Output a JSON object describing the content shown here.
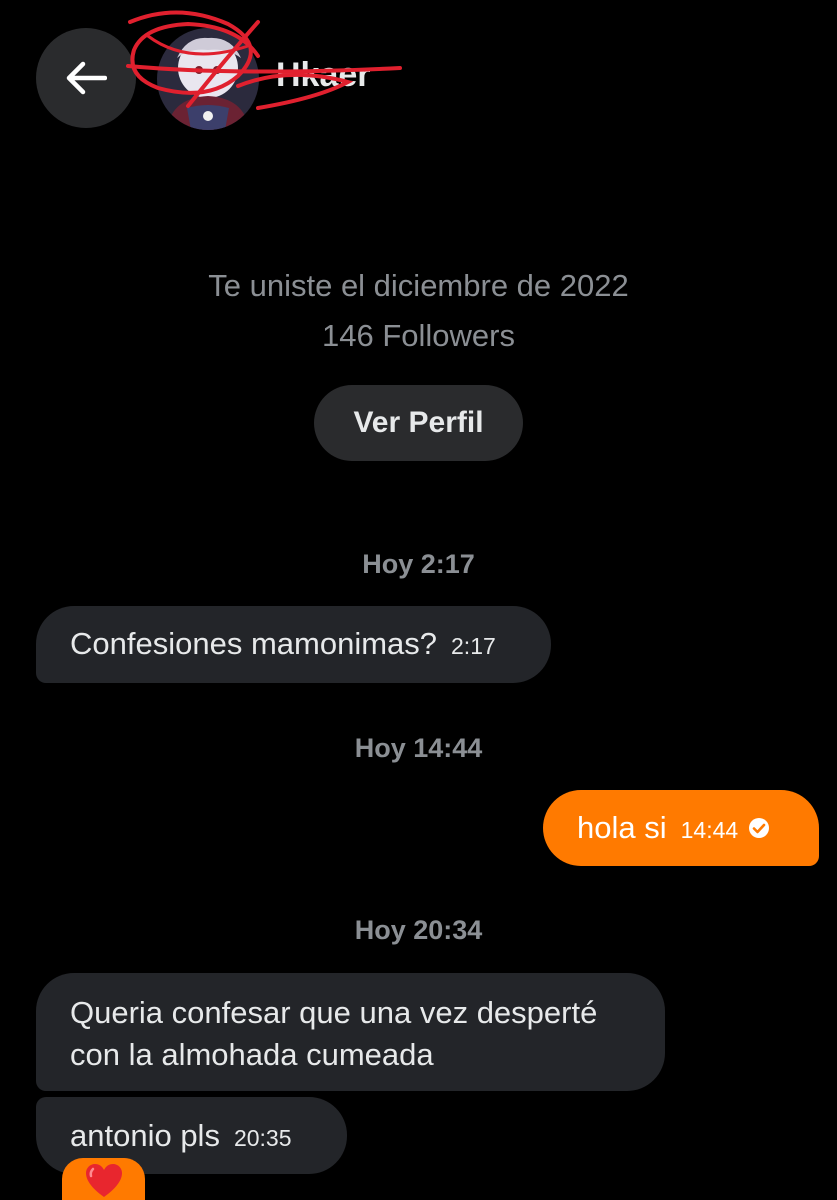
{
  "header": {
    "username": "Hkaer",
    "back_icon": "arrow-left-icon",
    "redaction_color": "#e0202e"
  },
  "profile": {
    "joined": "Te uniste el diciembre de 2022",
    "followers": "146 Followers",
    "view_profile_label": "Ver Perfil"
  },
  "conversation": {
    "day_stamps": [
      "Hoy 2:17",
      "Hoy 14:44",
      "Hoy 20:34"
    ],
    "messages": [
      {
        "direction": "incoming",
        "text": "Confesiones mamonimas?",
        "time": "2:17"
      },
      {
        "direction": "outgoing",
        "text": "hola si",
        "time": "14:44",
        "status_icon": "check-circle-icon"
      },
      {
        "direction": "incoming",
        "text_line1": "Queria confesar que una vez desperté",
        "text_line2": "con la almohada cumeada"
      },
      {
        "direction": "incoming",
        "text": "antonio pls",
        "time": "20:35"
      }
    ],
    "reaction": {
      "emoji": "heart-icon",
      "color": "#ff7a00"
    }
  },
  "colors": {
    "background": "#000000",
    "incoming_bubble": "#232529",
    "outgoing_bubble": "#ff7a00",
    "muted_text": "#8b8f94"
  }
}
